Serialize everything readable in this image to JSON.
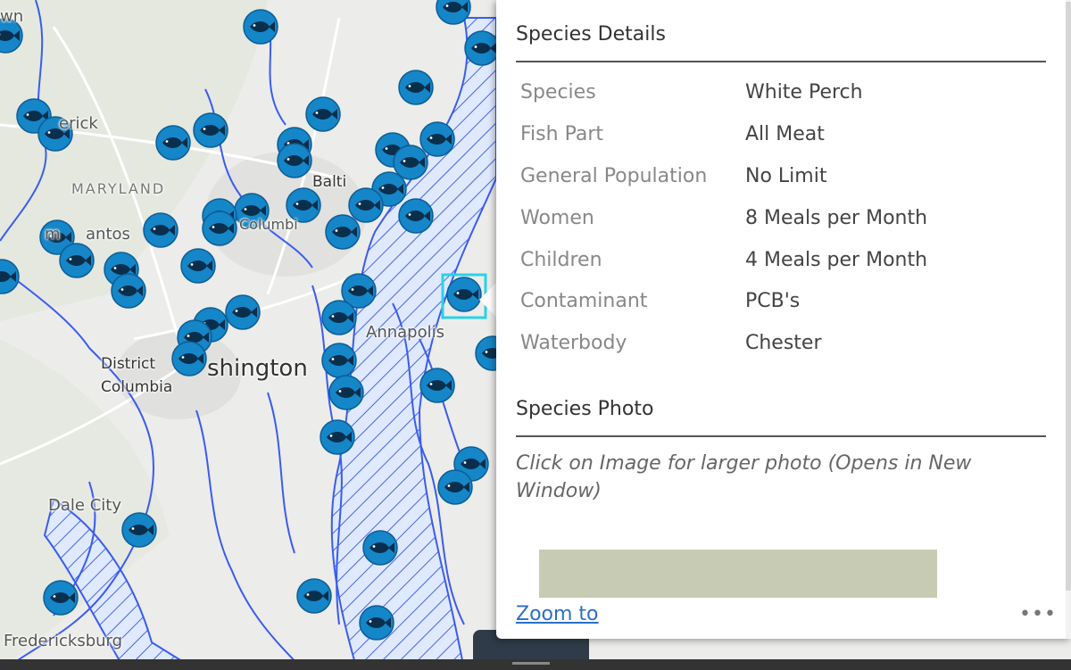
{
  "map": {
    "places": [
      "wn",
      "erick",
      "MARYLAND",
      "Balti",
      "Columbi",
      "m",
      "antos",
      "Annapolis",
      "District",
      "Columbia",
      "shington",
      "Dale City",
      "Fredericksburg"
    ],
    "colors": {
      "rivers": "#3a5cf0",
      "land": "#ececea",
      "marker": "#1586c8",
      "highlight": "#27d3e8",
      "roads": "#ffffff"
    },
    "marker_icon": "fish-icon",
    "selected_marker_icon": "fish-icon"
  },
  "popup": {
    "details_title": "Species Details",
    "details": [
      {
        "key": "Species",
        "value": "White Perch"
      },
      {
        "key": "Fish Part",
        "value": "All Meat"
      },
      {
        "key": "General Population",
        "value": "No Limit"
      },
      {
        "key": "Women",
        "value": "8 Meals per Month"
      },
      {
        "key": "Children",
        "value": "4 Meals per Month"
      },
      {
        "key": "Contaminant",
        "value": "PCB's"
      },
      {
        "key": "Waterbody",
        "value": "Chester"
      }
    ],
    "photo_title": "Species Photo",
    "photo_hint": "Click on Image for larger photo (Opens in New Window)",
    "zoom_label": "Zoom to",
    "more_label": "•••"
  }
}
